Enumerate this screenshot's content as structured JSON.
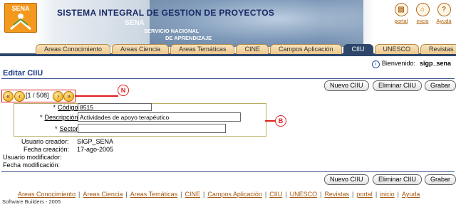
{
  "header": {
    "title": "SISTEMA INTEGRAL DE GESTION DE PROYECTOS",
    "logo_text": "SENA",
    "banner_word": "SENA",
    "banner_sub1": "SERVICIO NACIONAL",
    "banner_sub2": "DE APRENDIZAJE",
    "top_links": [
      {
        "label": "portal",
        "icon": "book-icon"
      },
      {
        "label": "inicio",
        "icon": "home-icon"
      },
      {
        "label": "Ayuda",
        "icon": "help-icon"
      }
    ]
  },
  "tabs": [
    {
      "label": "Areas Conocimiento"
    },
    {
      "label": "Areas Ciencia"
    },
    {
      "label": "Areas Temáticas"
    },
    {
      "label": "CINE"
    },
    {
      "label": "Campos Aplicación"
    },
    {
      "label": "CIIU",
      "active": true
    },
    {
      "label": "UNESCO"
    },
    {
      "label": "Revistas"
    }
  ],
  "welcome": {
    "label": "Bienvenido:",
    "user": "sigp_sena"
  },
  "page_title": "Editar CIIU",
  "buttons": {
    "nuevo": "Nuevo CIIU",
    "eliminar": "Eliminar CIIU",
    "grabar": "Grabar"
  },
  "navigator": {
    "counter": "[1 / 508]"
  },
  "callouts": {
    "nav": "N",
    "form": "B"
  },
  "form": {
    "codigo_label": "Código:",
    "codigo_value": "8515",
    "descripcion_label": "Descripción:",
    "descripcion_value": "Actividades de apoyo terapéutico",
    "sector_label": "Sector:",
    "sector_value": "",
    "required_mark": "*"
  },
  "info": {
    "usuario_creador_label": "Usuario creador:",
    "usuario_creador_value": "SIGP_SENA",
    "fecha_creacion_label": "Fecha creación:",
    "fecha_creacion_value": "17-ago-2005",
    "usuario_modificador_label": "Usuario modificador:",
    "fecha_modificacion_label": "Fecha modificación:"
  },
  "footer": {
    "links": [
      "Areas Conocimiento",
      "Areas Ciencia",
      "Areas Temáticas",
      "CINE",
      "Campos Aplicación",
      "CIIU",
      "UNESCO",
      "Revistas",
      "portal",
      "inicio",
      "Ayuda"
    ],
    "separator": "|",
    "copyright": "Software Builders - 2005"
  },
  "colors": {
    "accent": "#1e3c8a",
    "tab_active": "#2d466a",
    "callout": "#e01e1e",
    "form_border": "#b7ad62",
    "link": "#a3560c"
  }
}
